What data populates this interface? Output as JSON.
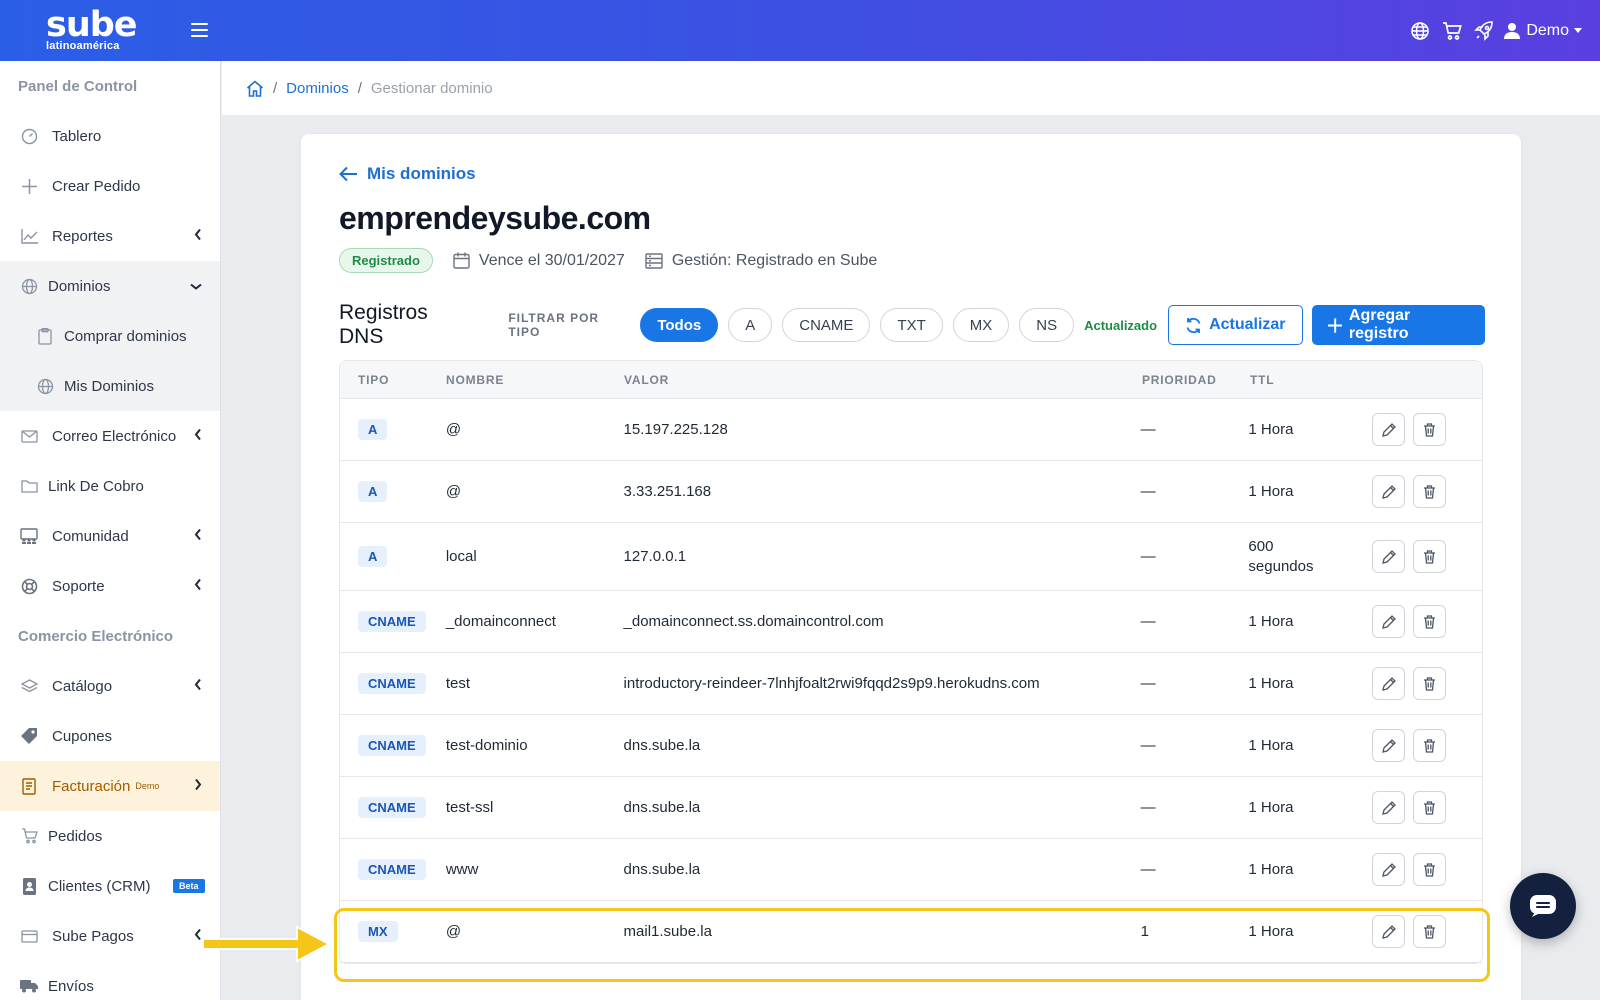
{
  "header": {
    "logo_main": "sube",
    "logo_sub": "latinoamérica",
    "user_label": "Demo"
  },
  "sidebar": {
    "section_panel": "Panel de Control",
    "section_ecommerce": "Comercio Electrónico",
    "items": [
      {
        "label": "Tablero",
        "icon": "gauge-icon"
      },
      {
        "label": "Crear Pedido",
        "icon": "plus-icon"
      },
      {
        "label": "Reportes",
        "icon": "chart-icon"
      },
      {
        "label": "Dominios",
        "icon": "globe-icon"
      },
      {
        "label": "Comprar dominios",
        "icon": "clipboard-icon"
      },
      {
        "label": "Mis Dominios",
        "icon": "globe-icon"
      },
      {
        "label": "Correo Electrónico",
        "icon": "mail-icon"
      },
      {
        "label": "Link De Cobro",
        "icon": "folder-icon"
      },
      {
        "label": "Comunidad",
        "icon": "community-icon"
      },
      {
        "label": "Soporte",
        "icon": "lifebuoy-icon"
      },
      {
        "label": "Catálogo",
        "icon": "layers-icon"
      },
      {
        "label": "Cupones",
        "icon": "tag-icon"
      },
      {
        "label": "Facturación",
        "icon": "invoice-icon",
        "sup": "Demo"
      },
      {
        "label": "Pedidos",
        "icon": "cart-icon"
      },
      {
        "label": "Clientes (CRM)",
        "icon": "contacts-icon",
        "badge": "Beta"
      },
      {
        "label": "Sube Pagos",
        "icon": "card-icon"
      },
      {
        "label": "Envíos",
        "icon": "truck-icon"
      }
    ]
  },
  "breadcrumb": {
    "dominios": "Dominios",
    "current": "Gestionar dominio"
  },
  "domain": {
    "back_label": "Mis dominios",
    "name": "emprendeysube.com",
    "status": "Registrado",
    "expires": "Vence el 30/01/2027",
    "management": "Gestión: Registrado en Sube"
  },
  "dns": {
    "title": "Registros DNS",
    "filter_label": "FILTRAR POR TIPO",
    "filters": [
      "Todos",
      "A",
      "CNAME",
      "TXT",
      "MX",
      "NS"
    ],
    "active_filter": "Todos",
    "updated_label": "Actualizado",
    "refresh_label": "Actualizar",
    "add_label": "Agregar registro",
    "columns": [
      "TIPO",
      "NOMBRE",
      "VALOR",
      "PRIORIDAD",
      "TTL"
    ],
    "rows": [
      {
        "tipo": "A",
        "nombre": "@",
        "valor": "15.197.225.128",
        "prioridad": "—",
        "ttl": "1 Hora"
      },
      {
        "tipo": "A",
        "nombre": "@",
        "valor": "3.33.251.168",
        "prioridad": "—",
        "ttl": "1 Hora"
      },
      {
        "tipo": "A",
        "nombre": "local",
        "valor": "127.0.0.1",
        "prioridad": "—",
        "ttl": "600 segundos"
      },
      {
        "tipo": "CNAME",
        "nombre": "_domainconnect",
        "valor": "_domainconnect.ss.domaincontrol.com",
        "prioridad": "—",
        "ttl": "1 Hora"
      },
      {
        "tipo": "CNAME",
        "nombre": "test",
        "valor": "introductory-reindeer-7lnhjfoalt2rwi9fqqd2s9p9.herokudns.com",
        "prioridad": "—",
        "ttl": "1 Hora"
      },
      {
        "tipo": "CNAME",
        "nombre": "test-dominio",
        "valor": "dns.sube.la",
        "prioridad": "—",
        "ttl": "1 Hora"
      },
      {
        "tipo": "CNAME",
        "nombre": "test-ssl",
        "valor": "dns.sube.la",
        "prioridad": "—",
        "ttl": "1 Hora"
      },
      {
        "tipo": "CNAME",
        "nombre": "www",
        "valor": "dns.sube.la",
        "prioridad": "—",
        "ttl": "1 Hora"
      },
      {
        "tipo": "MX",
        "nombre": "@",
        "valor": "mail1.sube.la",
        "prioridad": "1",
        "ttl": "1 Hora"
      }
    ]
  },
  "colors": {
    "accent": "#1976e6",
    "highlight": "#f5c518",
    "active_nav_bg": "#fdf3dd"
  }
}
